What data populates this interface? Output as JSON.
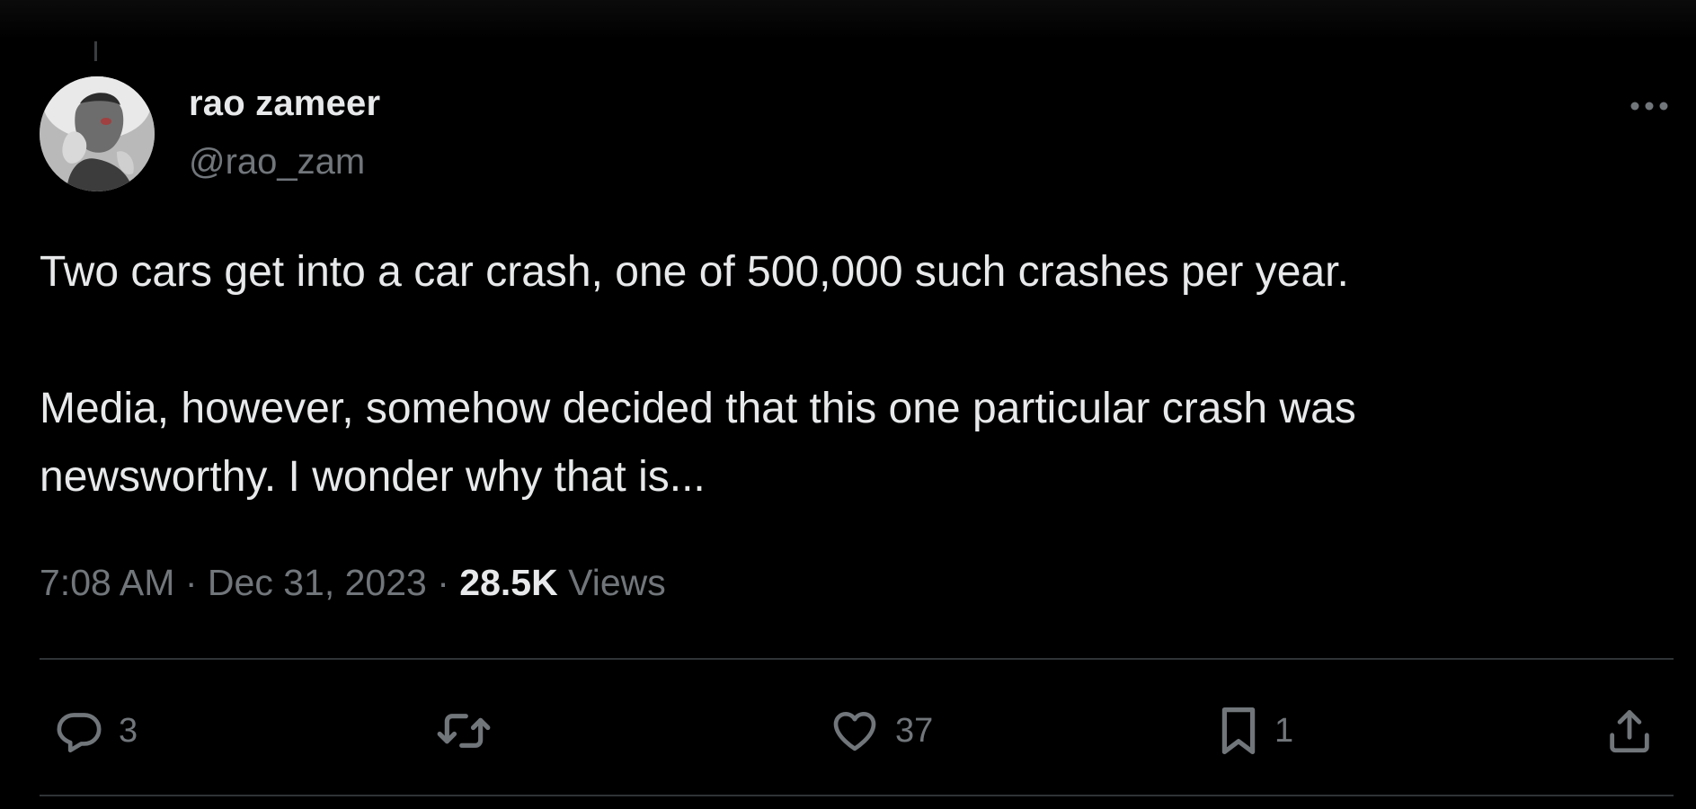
{
  "tweet": {
    "author": {
      "display_name": "rao zameer",
      "handle": "@rao_zam",
      "avatar_icon": "profile-photo"
    },
    "text_paragraphs": [
      "Two cars get into a car crash, one of 500,000 such crashes per year.",
      "Media, however, somehow decided that this one particular crash was\nnewsworthy. I wonder why that is..."
    ],
    "meta": {
      "time": "7:08 AM",
      "separator": "·",
      "date": "Dec 31, 2023",
      "views_count": "28.5K",
      "views_label": "Views"
    },
    "actions": {
      "reply": {
        "icon": "reply-icon",
        "count": "3"
      },
      "retweet": {
        "icon": "retweet-icon",
        "count": ""
      },
      "like": {
        "icon": "heart-icon",
        "count": "37"
      },
      "bookmark": {
        "icon": "bookmark-icon",
        "count": "1"
      },
      "share": {
        "icon": "share-icon",
        "count": ""
      }
    },
    "more_icon": "more-icon"
  },
  "colors": {
    "background": "#000000",
    "text_primary": "#e7e9ea",
    "text_secondary": "#71767b",
    "divider": "#2f3336"
  }
}
